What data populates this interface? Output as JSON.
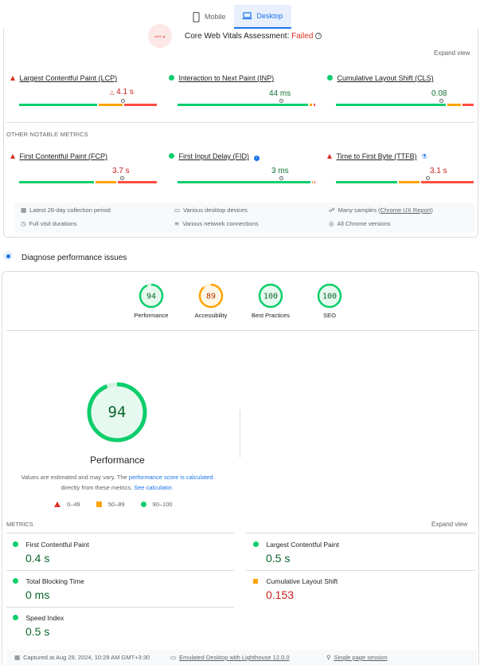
{
  "tabs": [
    {
      "label": "Mobile",
      "icon": "phone-icon",
      "active": false
    },
    {
      "label": "Desktop",
      "icon": "laptop-icon",
      "active": true
    }
  ],
  "cwv": {
    "logo_text": "crUX ▲",
    "title": "Core Web Vitals Assessment: ",
    "status": "Failed",
    "expand": "Expand view"
  },
  "core_metrics": [
    {
      "label": "Largest Contentful Paint (LCP)",
      "value": "4.1 s",
      "status": "poor",
      "bar": [
        55,
        18,
        18
      ],
      "marker": 0.73
    },
    {
      "label": "Interaction to Next Paint (INP)",
      "value": "44 ms",
      "status": "good",
      "bar": [
        95,
        3,
        2
      ],
      "marker": 0.75
    },
    {
      "label": "Cumulative Layout Shift (CLS)",
      "value": "0.08",
      "status": "good",
      "bar": [
        80,
        12,
        8
      ],
      "marker": 0.76
    }
  ],
  "other_title": "OTHER NOTABLE METRICS",
  "other_metrics": [
    {
      "label": "First Contentful Paint (FCP)",
      "value": "3.7 s",
      "status": "poor",
      "bar": [
        55,
        14,
        27
      ],
      "marker": 0.73
    },
    {
      "label": "First Input Delay (FID)",
      "value": "3 ms",
      "status": "good",
      "bar": [
        98,
        1,
        1
      ],
      "marker": 0.76
    },
    {
      "label": "Time to First Byte (TTFB)",
      "value": "3.1 s",
      "status": "poor",
      "bar": [
        44,
        16,
        40
      ],
      "marker": 0.66
    }
  ],
  "field_info": {
    "period": "Latest 28-day collection period",
    "durations": "Full visit durations",
    "devices": "Various desktop devices",
    "network": "Various network connections",
    "samples_prefix": "Many samples (",
    "samples_link": "Chrome UX Report",
    "samples_suffix": ")",
    "versions": "All Chrome versions"
  },
  "diagnose_title": "Diagnose performance issues",
  "scores": [
    {
      "label": "Performance",
      "score": "94",
      "color": "#0cce6b"
    },
    {
      "label": "Accessibility",
      "score": "89",
      "color": "#ffa400"
    },
    {
      "label": "Best Practices",
      "score": "100",
      "color": "#0cce6b"
    },
    {
      "label": "SEO",
      "score": "100",
      "color": "#0cce6b"
    }
  ],
  "big_score": {
    "score": "94",
    "title": "Performance",
    "note_1": "Values are estimated and may vary. The ",
    "note_link": "performance score is calculated",
    "note_2": "directly from these metrics. ",
    "note_link2": "See calculator."
  },
  "legend": [
    {
      "shape": "triangle",
      "label": "0–49"
    },
    {
      "shape": "square",
      "label": "50–89"
    },
    {
      "shape": "circle",
      "label": "90–100"
    }
  ],
  "lab": {
    "title": "METRICS",
    "expand": "Expand view",
    "metrics": [
      {
        "label": "First Contentful Paint",
        "value": "0.4 s",
        "status": "good"
      },
      {
        "label": "Largest Contentful Paint",
        "value": "0.5 s",
        "status": "good"
      },
      {
        "label": "Total Blocking Time",
        "value": "0 ms",
        "status": "good"
      },
      {
        "label": "Cumulative Layout Shift",
        "value": "0.153",
        "status": "average"
      },
      {
        "label": "Speed Index",
        "value": "0.5 s",
        "status": "good"
      }
    ]
  },
  "footer": {
    "captured": "Captured at Aug 29, 2024, 10:28 AM GMT+3:30",
    "emulated": "Emulated Desktop with Lighthouse 12.0.0",
    "session": "Single page session"
  }
}
